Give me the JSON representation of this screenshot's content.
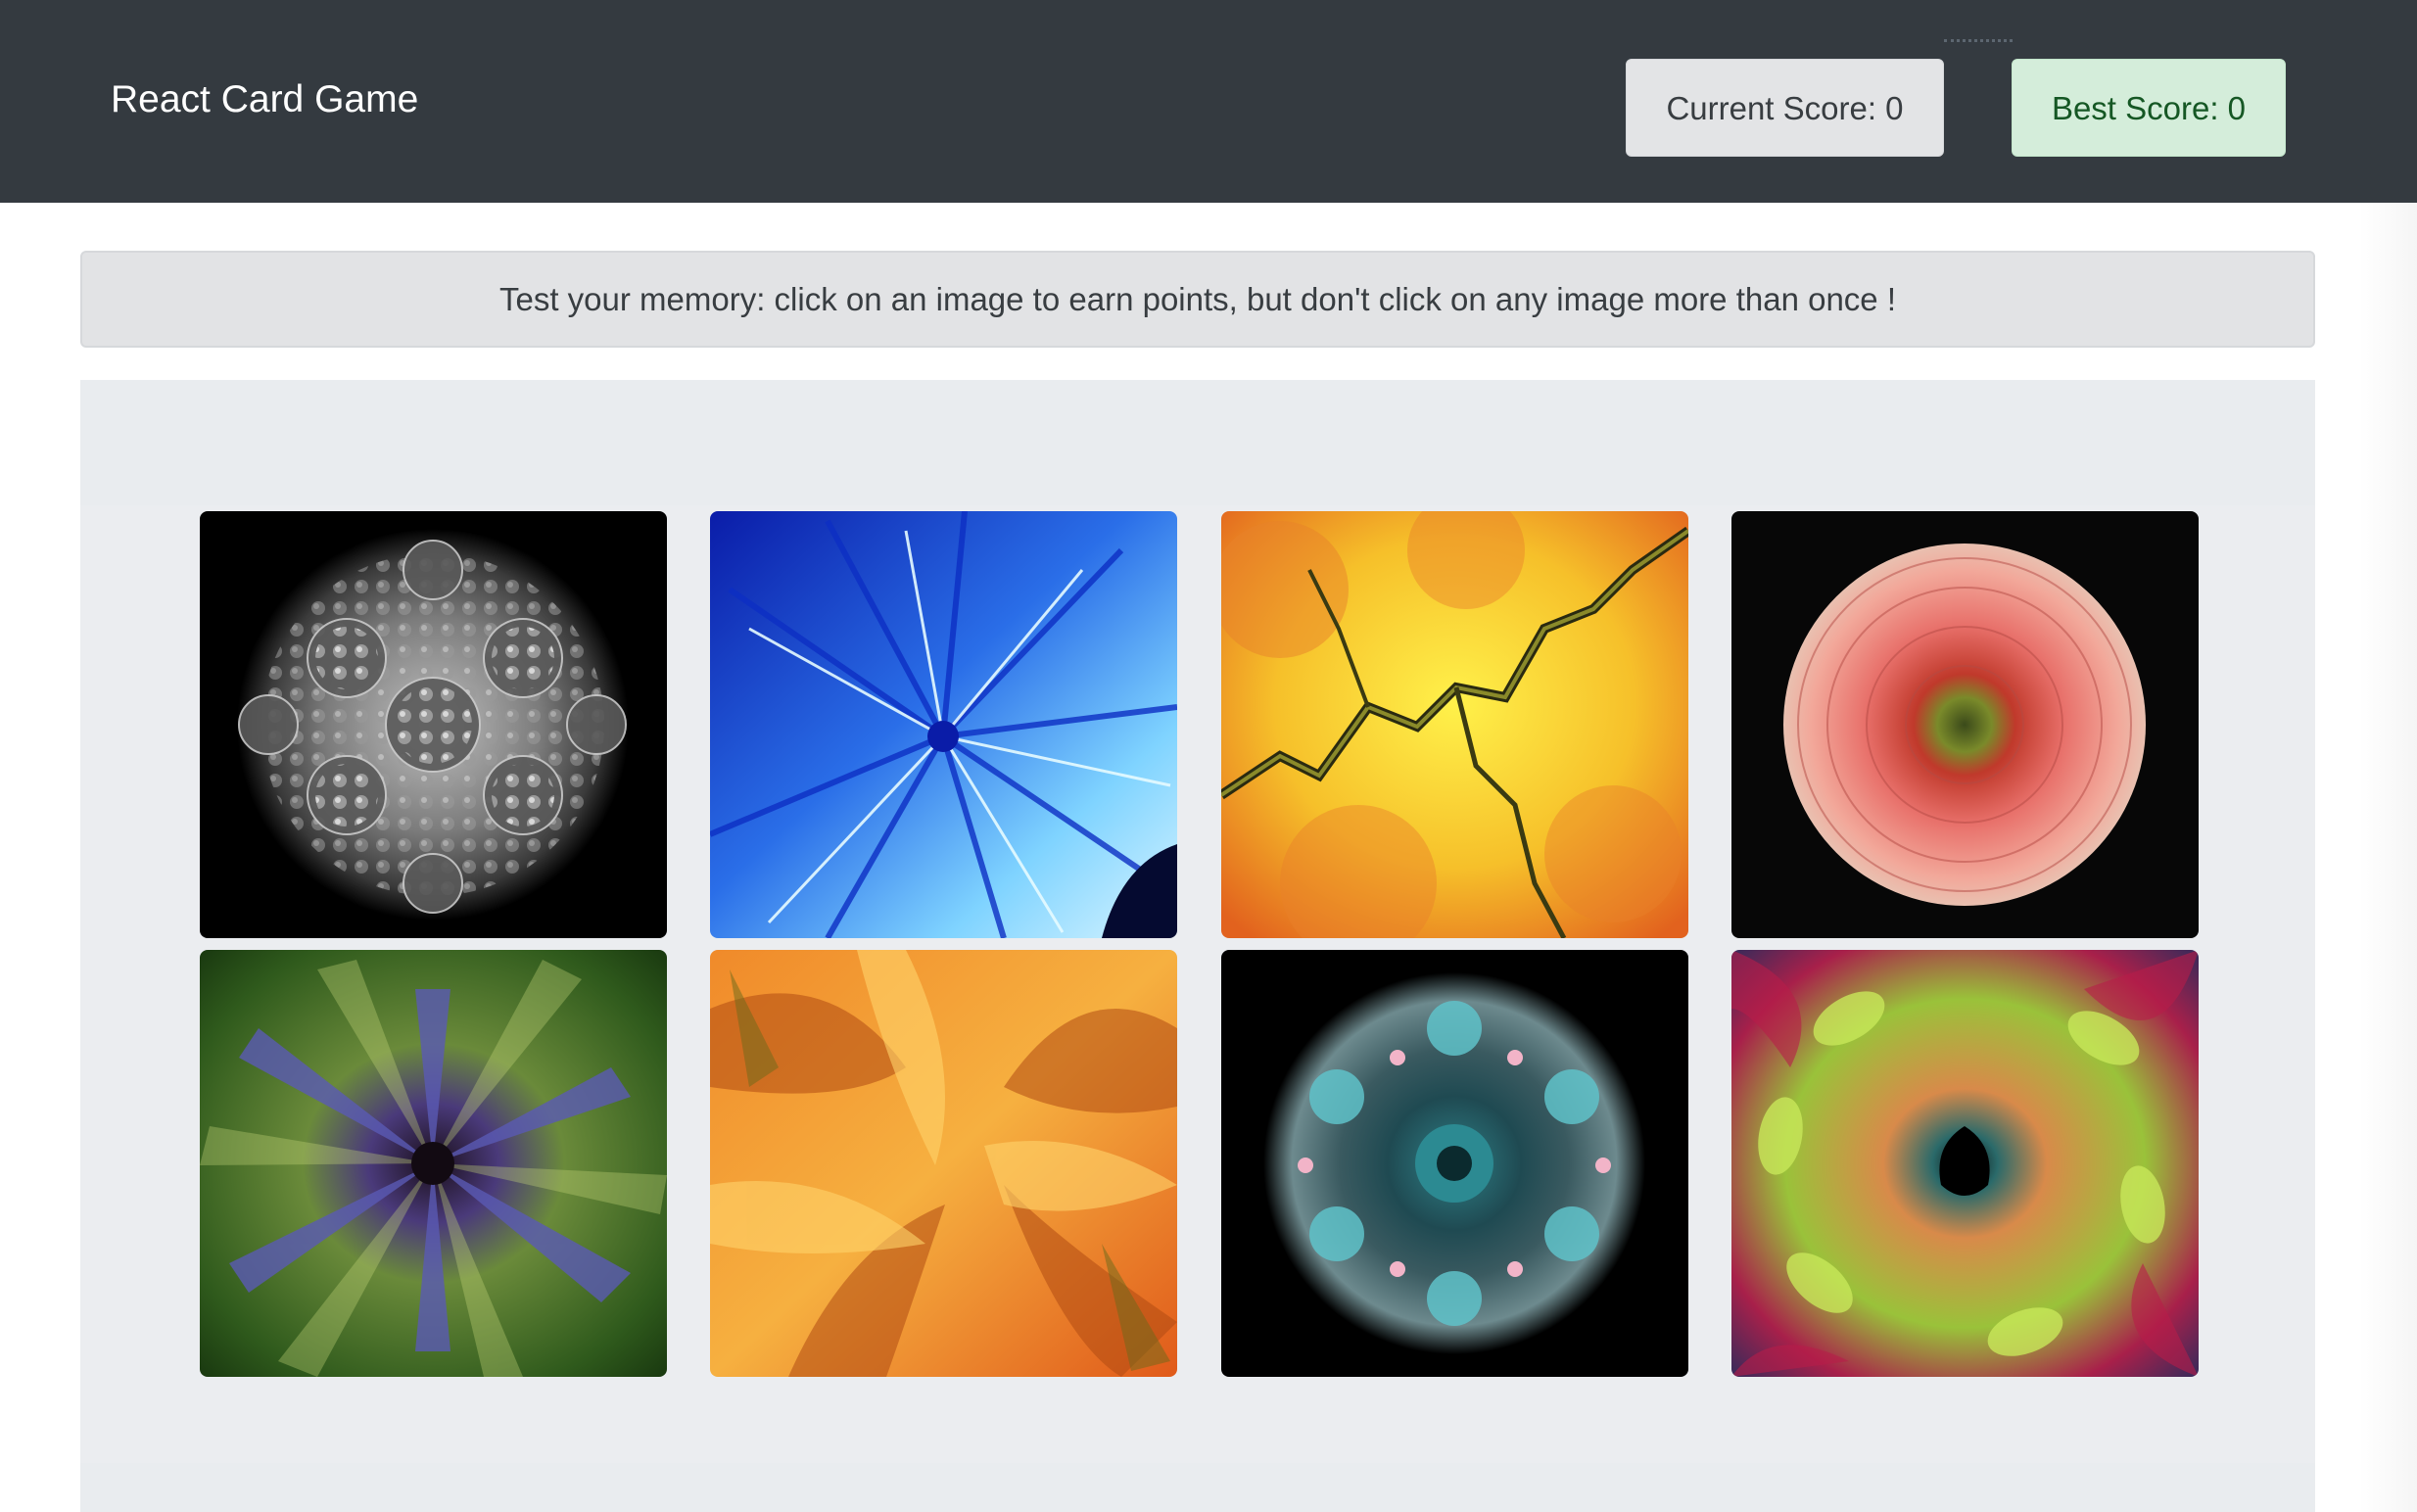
{
  "navbar": {
    "brand": "React Card Game",
    "current_score_label": "Current Score: 0",
    "best_score_label": "Best Score: 0"
  },
  "instructions": {
    "text": "Test your memory: click on an image to earn points, but don't click on any image more than once !"
  },
  "cards": [
    {
      "name": "card-fractal-gray-mandelbulb",
      "icon": "gray-3d-fractal-image"
    },
    {
      "name": "card-fractal-blue-julia",
      "icon": "blue-julia-fractal-image"
    },
    {
      "name": "card-fractal-yellow-lightning",
      "icon": "yellow-orange-fractal-image"
    },
    {
      "name": "card-fractal-pink-flower",
      "icon": "pink-flower-fractal-image"
    },
    {
      "name": "card-fractal-green-star",
      "icon": "green-star-fractal-image"
    },
    {
      "name": "card-fractal-orange-swirl",
      "icon": "orange-swirl-fractal-image"
    },
    {
      "name": "card-fractal-teal-snowflake",
      "icon": "teal-snowflake-fractal-image"
    },
    {
      "name": "card-fractal-green-spiral",
      "icon": "green-spiral-fractal-image"
    }
  ],
  "colors": {
    "navbar": "#343a40",
    "current_score_bg": "#e3e4e6",
    "best_score_bg": "#d4edda",
    "best_score_text": "#155724",
    "instructions_bg": "#e2e3e5",
    "board_bg": "#e9ecef"
  }
}
